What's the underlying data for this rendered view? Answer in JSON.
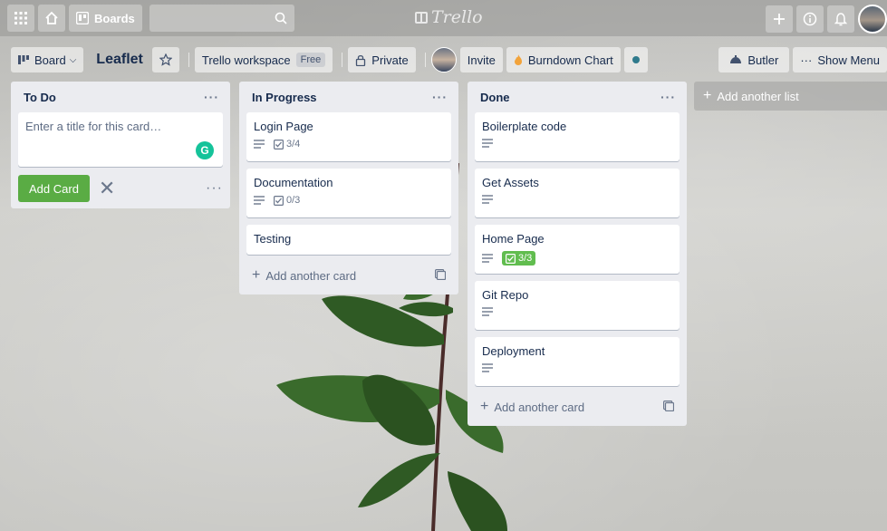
{
  "header": {
    "boards_label": "Boards",
    "logo_text": "Trello"
  },
  "board": {
    "view_label": "Board",
    "title": "Leaflet",
    "workspace_label": "Trello workspace",
    "workspace_plan": "Free",
    "visibility_label": "Private",
    "invite_label": "Invite",
    "burndown_label": "Burndown Chart",
    "butler_label": "Butler",
    "show_menu_label": "Show Menu"
  },
  "lists": {
    "todo": {
      "title": "To Do",
      "composer_placeholder": "Enter a title for this card…",
      "add_card_button": "Add Card"
    },
    "inprogress": {
      "title": "In Progress",
      "cards": [
        {
          "title": "Login Page",
          "checklist": "3/4"
        },
        {
          "title": "Documentation",
          "checklist": "0/3"
        },
        {
          "title": "Testing"
        }
      ],
      "add_another_card": "Add another card"
    },
    "done": {
      "title": "Done",
      "cards": [
        {
          "title": "Boilerplate code"
        },
        {
          "title": "Get Assets"
        },
        {
          "title": "Home Page",
          "checklist": "3/3"
        },
        {
          "title": "Git Repo"
        },
        {
          "title": "Deployment"
        }
      ],
      "add_another_card": "Add another card"
    }
  },
  "add_another_list": "Add another list",
  "colors": {
    "add_card_green": "#5aac44",
    "complete_badge_green": "#61bd4f",
    "list_bg": "#ebecf0"
  }
}
